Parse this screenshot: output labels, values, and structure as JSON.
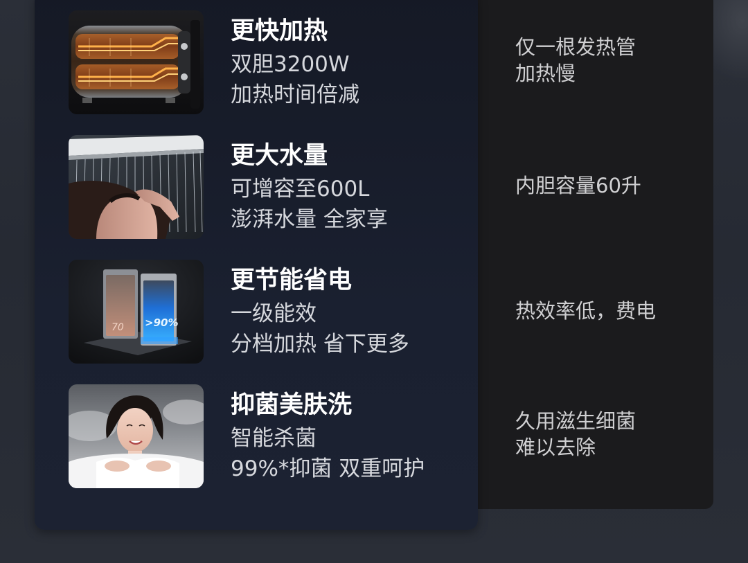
{
  "features": [
    {
      "icon": "water-heater-tank-image",
      "title": "更快加热",
      "line1": "双胆3200W",
      "line2": "加热时间倍减",
      "compare_line1": "仅一根发热管",
      "compare_line2": "加热慢"
    },
    {
      "icon": "rain-shower-image",
      "title": "更大水量",
      "line1": "可增容至600L",
      "line2": "澎湃水量 全家享",
      "compare_line1": "内胆容量60升",
      "compare_line2": ""
    },
    {
      "icon": "energy-efficiency-tanks-image",
      "title": "更节能省电",
      "line1": "一级能效",
      "line2": "分档加热 省下更多",
      "compare_line1": "热效率低，费电",
      "compare_line2": "",
      "image_text": {
        "left_label": "70",
        "right_label": ">90%"
      }
    },
    {
      "icon": "bath-woman-image",
      "title": "抑菌美肤洗",
      "line1": "智能杀菌",
      "line2": "99%*抑菌 双重呵护",
      "compare_line1": "久用滋生细菌",
      "compare_line2": "难以去除"
    }
  ],
  "colors": {
    "page_background": "#282c35",
    "feature_panel": "#171c29",
    "compare_panel": "#1b1b1d",
    "title_text": "#ffffff",
    "body_text": "#d6d8dd",
    "compare_text": "#d0d0d2"
  }
}
